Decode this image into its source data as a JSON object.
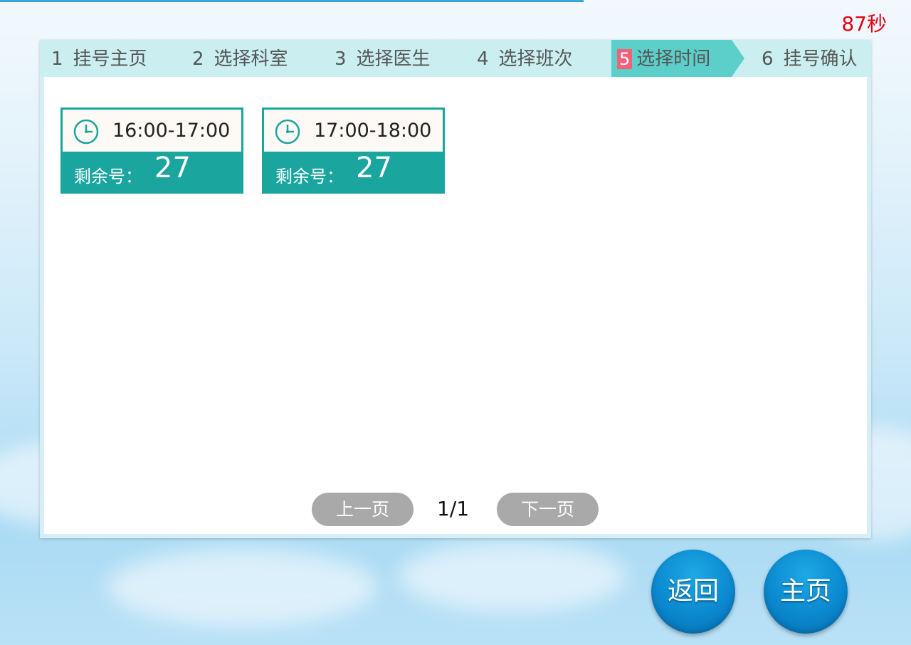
{
  "countdown": "87秒",
  "steps": [
    {
      "num": "1",
      "label": "挂号主页"
    },
    {
      "num": "2",
      "label": "选择科室"
    },
    {
      "num": "3",
      "label": "选择医生"
    },
    {
      "num": "4",
      "label": "选择班次"
    },
    {
      "num": "5",
      "label": "选择时间"
    },
    {
      "num": "6",
      "label": "挂号确认"
    }
  ],
  "active_step": 5,
  "slots": [
    {
      "time": "16:00-17:00",
      "remaining_label": "剩余号：",
      "remaining": "27"
    },
    {
      "time": "17:00-18:00",
      "remaining_label": "剩余号：",
      "remaining": "27"
    }
  ],
  "pager": {
    "prev": "上一页",
    "page": "1/1",
    "next": "下一页"
  },
  "buttons": {
    "back": "返回",
    "home": "主页"
  },
  "colors": {
    "accent": "#1aa59f",
    "active_step": "#5dcfcb",
    "step_bar": "#cbeff0",
    "countdown": "#e60012",
    "button_blue": "#0b89cf"
  },
  "icons": {
    "slot": "clock-icon"
  }
}
